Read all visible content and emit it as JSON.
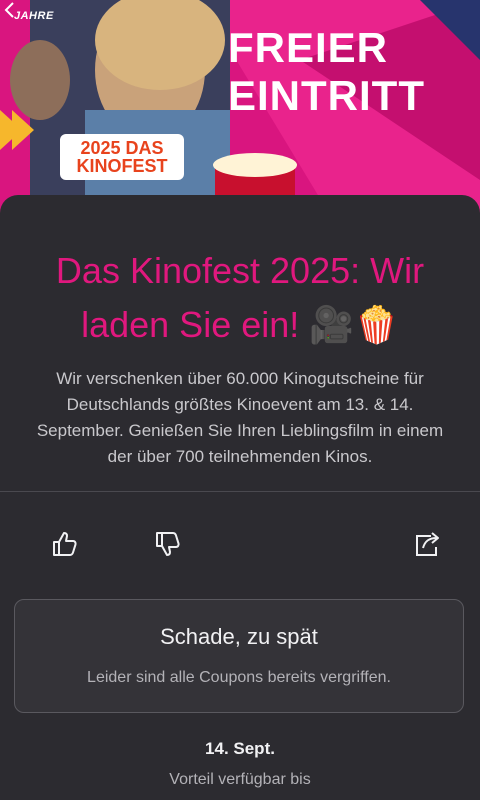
{
  "hero": {
    "badge": "JAHRE",
    "headline_line1": "FREIER",
    "headline_line2": "EINTRITT",
    "ticket_line1": "2025 DAS",
    "ticket_line2": "KINOFEST"
  },
  "content": {
    "title": "Das Kinofest 2025: Wir laden Sie ein! 🎥🍿",
    "description": "Wir verschenken über 60.000 Kinogutscheine für Deutschlands größtes Kinoevent am 13. & 14. September. Genießen Sie Ihren Lieblingsfilm in einem der über 700 teilnehmenden Kinos."
  },
  "actions": {
    "like_icon": "thumbs-up-icon",
    "dislike_icon": "thumbs-down-icon",
    "share_icon": "share-icon"
  },
  "status_card": {
    "title": "Schade, zu spät",
    "subtitle": "Leider sind alle Coupons bereits vergriffen."
  },
  "availability": {
    "date": "14. Sept.",
    "label": "Vorteil verfügbar bis"
  },
  "colors": {
    "accent": "#e0187e",
    "background": "#2c2b30"
  }
}
